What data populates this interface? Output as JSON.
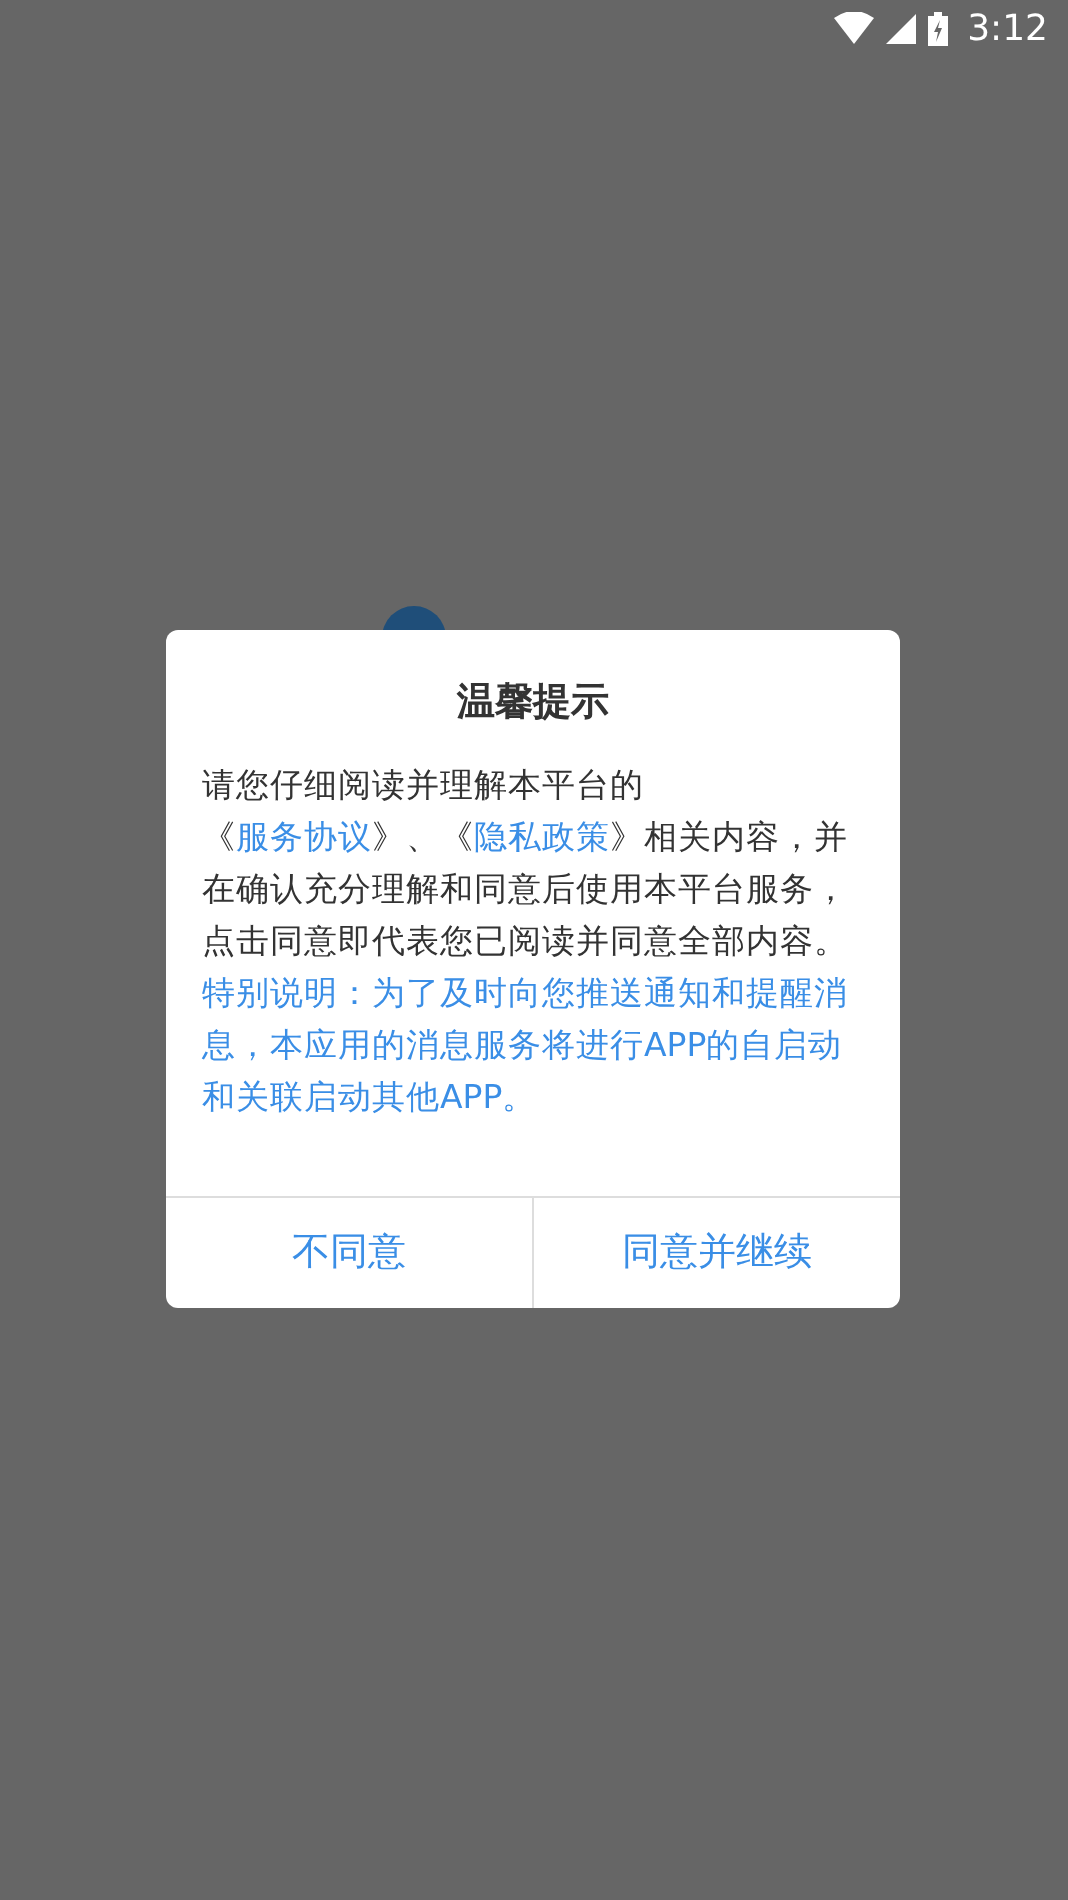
{
  "status_bar": {
    "time": "3:12"
  },
  "dialog": {
    "title": "温馨提示",
    "body": [
      {
        "kind": "text",
        "text": "请您仔细阅读并理解本平台的《"
      },
      {
        "kind": "link",
        "text": "服务协议"
      },
      {
        "kind": "text",
        "text": "》、《"
      },
      {
        "kind": "link",
        "text": "隐私政策"
      },
      {
        "kind": "text",
        "text": "》相关内容，并在确认充分理解和同意后使用本平台服务，点击同意即代表您已阅读并同意全部内容。"
      }
    ],
    "notice": "特别说明：为了及时向您推送通知和提醒消息，本应用的消息服务将进行APP的自启动和关联启动其他APP。",
    "buttons": [
      "不同意",
      "同意并继续"
    ]
  }
}
